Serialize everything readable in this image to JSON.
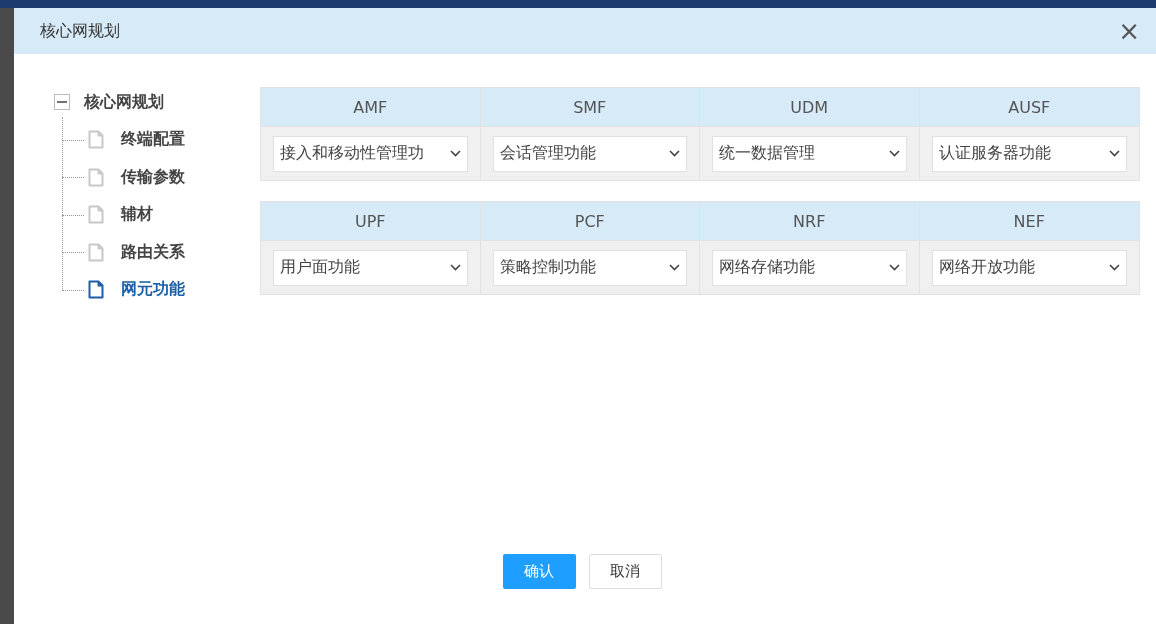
{
  "dialog": {
    "title": "核心网规划",
    "close": "×"
  },
  "tree": {
    "label": "核心网规划",
    "expanded": true,
    "children": [
      {
        "label": "终端配置",
        "selected": false
      },
      {
        "label": "传输参数",
        "selected": false
      },
      {
        "label": "辅材",
        "selected": false
      },
      {
        "label": "路由关系",
        "selected": false
      },
      {
        "label": "网元功能",
        "selected": true
      }
    ]
  },
  "tables": [
    {
      "columns": [
        {
          "header": "AMF",
          "value": "接入和移动性管理功"
        },
        {
          "header": "SMF",
          "value": "会话管理功能"
        },
        {
          "header": "UDM",
          "value": "统一数据管理"
        },
        {
          "header": "AUSF",
          "value": "认证服务器功能"
        }
      ]
    },
    {
      "columns": [
        {
          "header": "UPF",
          "value": "用户面功能"
        },
        {
          "header": "PCF",
          "value": "策略控制功能"
        },
        {
          "header": "NRF",
          "value": "网络存储功能"
        },
        {
          "header": "NEF",
          "value": "网络开放功能"
        }
      ]
    }
  ],
  "buttons": [
    {
      "label": "确认",
      "kind": "primary"
    },
    {
      "label": "取消",
      "kind": "default"
    }
  ]
}
